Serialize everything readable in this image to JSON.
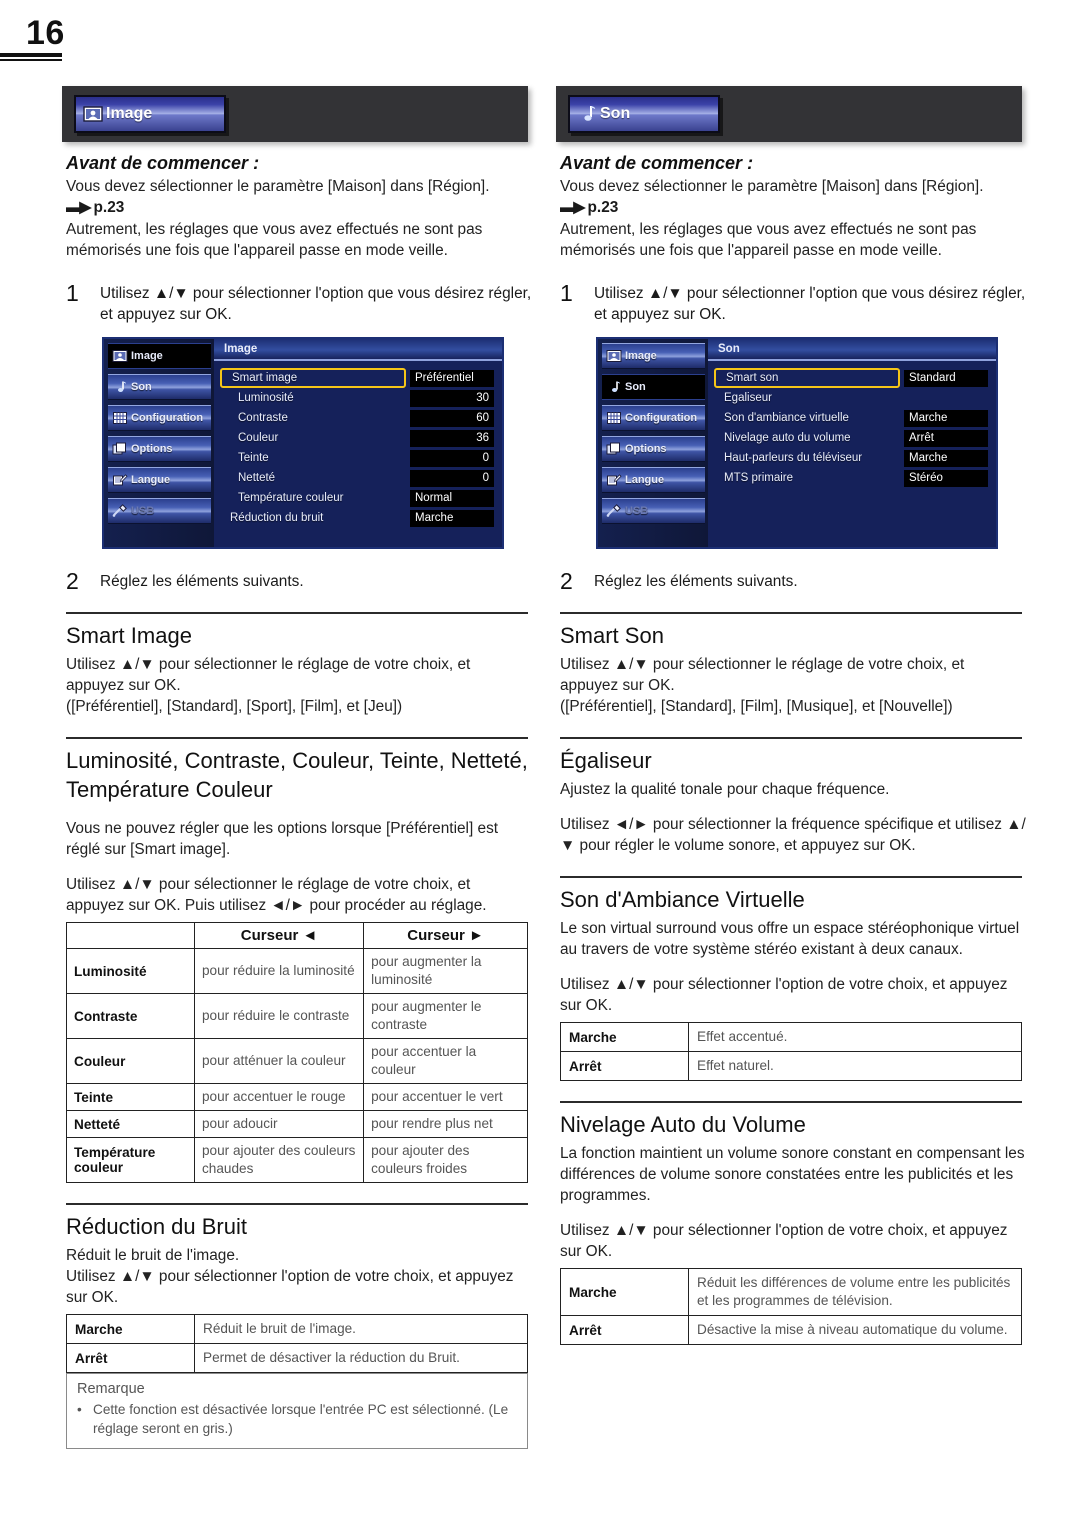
{
  "page": {
    "number": "16"
  },
  "columns": [
    {
      "banner": {
        "label": "Image",
        "icon": "picture-icon"
      },
      "avant_title": "Avant de commencer :",
      "avant_line1": "Vous devez sélectionner le paramètre [Maison] dans [Région].",
      "avant_ref": "p.23",
      "avant_line2": "Autrement, les réglages que vous avez effectués ne sont pas mémorisés une fois que l'appareil passe en mode veille.",
      "step1": {
        "num": "1",
        "text": "Utilisez ▲/▼ pour sélectionner l'option que vous désirez régler, et appuyez sur OK."
      },
      "step2": {
        "num": "2",
        "text": "Réglez les éléments suivants."
      },
      "osd": {
        "title": "Image",
        "sidebar": [
          {
            "label": "Image",
            "icon": "picture-icon",
            "state": "active"
          },
          {
            "label": "Son",
            "icon": "note-icon",
            "state": "normal"
          },
          {
            "label": "Configuration",
            "icon": "grid-icon",
            "state": "normal"
          },
          {
            "label": "Options",
            "icon": "layers-icon",
            "state": "normal"
          },
          {
            "label": "Langue",
            "icon": "pencil-icon",
            "state": "normal"
          },
          {
            "label": "USB",
            "icon": "usb-icon",
            "state": "dim"
          }
        ],
        "rows": [
          {
            "label": "Smart image",
            "value": "Préférentiel",
            "selected": true,
            "indent": false,
            "align": "left"
          },
          {
            "label": "Luminosité",
            "value": "30",
            "selected": false,
            "indent": true,
            "align": "right"
          },
          {
            "label": "Contraste",
            "value": "60",
            "selected": false,
            "indent": true,
            "align": "right"
          },
          {
            "label": "Couleur",
            "value": "36",
            "selected": false,
            "indent": true,
            "align": "right"
          },
          {
            "label": "Teinte",
            "value": "0",
            "selected": false,
            "indent": true,
            "align": "right"
          },
          {
            "label": "Netteté",
            "value": "0",
            "selected": false,
            "indent": true,
            "align": "right"
          },
          {
            "label": "Température couleur",
            "value": "Normal",
            "selected": false,
            "indent": true,
            "align": "left"
          },
          {
            "label": "Réduction du bruit",
            "value": "Marche",
            "selected": false,
            "indent": false,
            "align": "left"
          }
        ]
      },
      "sections": [
        {
          "heading": "Smart Image",
          "paras": [
            "Utilisez ▲/▼ pour sélectionner le réglage de votre choix, et appuyez sur OK.",
            "([Préférentiel], [Standard], [Sport], [Film], et [Jeu])"
          ]
        },
        {
          "heading": "Luminosité, Contraste, Couleur, Teinte, Netteté, Température Couleur",
          "paras": [
            "Vous ne pouvez régler que les options lorsque [Préférentiel] est réglé sur [Smart image].",
            "Utilisez ▲/▼ pour sélectionner le réglage de votre choix, et appuyez sur OK. Puis utilisez ◄/► pour procéder au réglage."
          ]
        }
      ],
      "cursor_table": {
        "headers": [
          "",
          "Curseur ◄",
          "Curseur ►"
        ],
        "rows": [
          {
            "key": "Luminosité",
            "left": "pour réduire la luminosité",
            "right": "pour augmenter la luminosité"
          },
          {
            "key": "Contraste",
            "left": "pour réduire le contraste",
            "right": "pour augmenter le contraste"
          },
          {
            "key": "Couleur",
            "left": "pour atténuer la couleur",
            "right": "pour accentuer la couleur"
          },
          {
            "key": "Teinte",
            "left": "pour accentuer le rouge",
            "right": "pour accentuer le vert"
          },
          {
            "key": "Netteté",
            "left": "pour adoucir",
            "right": "pour rendre plus net"
          },
          {
            "key": "Température couleur",
            "left": "pour ajouter des couleurs chaudes",
            "right": "pour ajouter des couleurs froides"
          }
        ]
      },
      "noise": {
        "heading": "Réduction du Bruit",
        "para1": "Réduit le bruit de l'image.",
        "para2": "Utilisez ▲/▼ pour sélectionner l'option de votre choix, et appuyez sur OK.",
        "table": [
          {
            "key": "Marche",
            "desc": "Réduit le bruit de l'image."
          },
          {
            "key": "Arrêt",
            "desc": "Permet de désactiver la réduction du Bruit."
          }
        ]
      },
      "remark": {
        "title": "Remarque",
        "bullet": "•",
        "text": "Cette fonction est désactivée lorsque l'entrée PC est sélectionné. (Le réglage seront en gris.)"
      }
    },
    {
      "banner": {
        "label": "Son",
        "icon": "note-icon"
      },
      "avant_title": "Avant de commencer :",
      "avant_line1": "Vous devez sélectionner le paramètre [Maison] dans [Région].",
      "avant_ref": "p.23",
      "avant_line2": "Autrement, les réglages que vous avez effectués ne sont pas mémorisés une fois que l'appareil passe en mode veille.",
      "step1": {
        "num": "1",
        "text": "Utilisez ▲/▼ pour sélectionner l'option que vous désirez régler, et appuyez sur OK."
      },
      "step2": {
        "num": "2",
        "text": "Réglez les éléments suivants."
      },
      "osd": {
        "title": "Son",
        "sidebar": [
          {
            "label": "Image",
            "icon": "picture-icon",
            "state": "normal"
          },
          {
            "label": "Son",
            "icon": "note-icon",
            "state": "active"
          },
          {
            "label": "Configuration",
            "icon": "grid-icon",
            "state": "normal"
          },
          {
            "label": "Options",
            "icon": "layers-icon",
            "state": "normal"
          },
          {
            "label": "Langue",
            "icon": "pencil-icon",
            "state": "normal"
          },
          {
            "label": "USB",
            "icon": "usb-icon",
            "state": "dim"
          }
        ],
        "rows": [
          {
            "label": "Smart son",
            "value": "Standard",
            "selected": true,
            "indent": false,
            "align": "left"
          },
          {
            "label": "Egaliseur",
            "value": "",
            "selected": false,
            "indent": false,
            "align": "left"
          },
          {
            "label": "Son d'ambiance virtuelle",
            "value": "Marche",
            "selected": false,
            "indent": false,
            "align": "left"
          },
          {
            "label": "Nivelage auto du volume",
            "value": "Arrêt",
            "selected": false,
            "indent": false,
            "align": "left"
          },
          {
            "label": "Haut-parleurs du téléviseur",
            "value": "Marche",
            "selected": false,
            "indent": false,
            "align": "left"
          },
          {
            "label": "MTS primaire",
            "value": "Stéréo",
            "selected": false,
            "indent": false,
            "align": "left"
          }
        ]
      },
      "sections": [
        {
          "heading": "Smart Son",
          "paras": [
            "Utilisez ▲/▼ pour sélectionner le réglage de votre choix, et appuyez sur OK.",
            "([Préférentiel], [Standard], [Film], [Musique], et [Nouvelle])"
          ]
        },
        {
          "heading": "Égaliseur",
          "paras": [
            "Ajustez la qualité tonale pour chaque fréquence.",
            "Utilisez ◄/► pour sélectionner la fréquence spécifique et utilisez ▲/▼ pour régler le volume sonore, et appuyez sur OK."
          ]
        }
      ],
      "virtual": {
        "heading": "Son d'Ambiance Virtuelle",
        "para1": "Le son virtual surround vous offre un espace stéréophonique virtuel au travers de votre système stéréo existant à deux canaux.",
        "para2": "Utilisez ▲/▼ pour sélectionner l'option de votre choix, et appuyez sur OK.",
        "table": [
          {
            "key": "Marche",
            "desc": "Effet accentué."
          },
          {
            "key": "Arrêt",
            "desc": "Effet naturel."
          }
        ]
      },
      "leveling": {
        "heading": "Nivelage Auto du Volume",
        "para1": "La fonction maintient un volume sonore constant en compensant les différences de volume sonore constatées entre les publicités et les programmes.",
        "para2": "Utilisez ▲/▼ pour sélectionner l'option de votre choix, et appuyez sur OK.",
        "table": [
          {
            "key": "Marche",
            "desc": "Réduit les différences de volume entre les publicités et les programmes de télévision."
          },
          {
            "key": "Arrêt",
            "desc": "Désactive la mise à niveau automatique du volume."
          }
        ]
      }
    }
  ],
  "colors": {
    "banner_bg": "#333336",
    "tab_blue": "#3b42a8",
    "osd_bg": "#15215a",
    "highlight_yellow": "#f5c518",
    "text": "#1a1a1a",
    "table_desc": "#555555"
  }
}
